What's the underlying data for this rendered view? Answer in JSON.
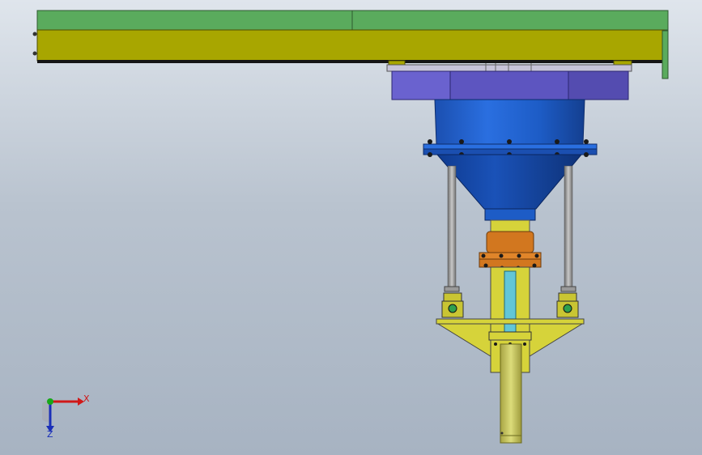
{
  "viewport": {
    "background_top": "#dfe5ec",
    "background_bottom": "#a7b3c2"
  },
  "model": {
    "colors": {
      "beam_green": "#5aab5d",
      "beam_olive": "#a8a600",
      "plate_purple": "#6a62c8",
      "hopper_blue": "#1f5fcf",
      "flange_orange": "#d2771f",
      "support_yellow": "#d6d33a",
      "rod_gray": "#9a9a9a",
      "pipe_cyan": "#62c6d6"
    }
  },
  "triad": {
    "x_label": "X",
    "z_label": "Z",
    "x_color": "#d01818",
    "y_color": "#18a818",
    "z_color": "#1a2fb8"
  }
}
